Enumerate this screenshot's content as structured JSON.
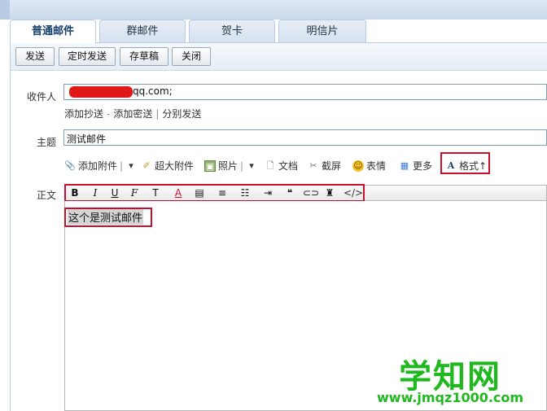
{
  "tabs": [
    {
      "label": "普通邮件",
      "active": true
    },
    {
      "label": "群邮件",
      "active": false
    },
    {
      "label": "贺卡",
      "active": false
    },
    {
      "label": "明信片",
      "active": false
    }
  ],
  "toolbar": {
    "send": "发送",
    "scheduled_send": "定时发送",
    "save_draft": "存草稿",
    "close": "关闭"
  },
  "recipient": {
    "label": "收件人",
    "value_visible": "qq.com;",
    "redaction_color": "#e01818"
  },
  "recipient_links": {
    "add_cc": "添加抄送",
    "dash": "-",
    "add_bcc": "添加密送",
    "pipe": "|",
    "separate_send": "分别发送"
  },
  "subject": {
    "label": "主题",
    "value": "测试邮件"
  },
  "attach_bar": {
    "add_attachment": "添加附件",
    "large_attachment": "超大附件",
    "photo": "照片",
    "document": "文档",
    "screenshot": "截屏",
    "emoji": "表情",
    "more": "更多",
    "format": "格式↑"
  },
  "body": {
    "label": "正文",
    "content": "这个是测试邮件"
  },
  "format_toolbar": {
    "icons": [
      "bold-icon",
      "italic-icon",
      "underline-icon",
      "font-icon",
      "font-size-icon",
      "font-color-icon",
      "background-color-icon",
      "align-icon",
      "bullet-list-icon",
      "indent-icon",
      "quote-icon",
      "link-icon",
      "clear-format-icon",
      "html-source-icon"
    ],
    "labels": [
      "B",
      "I",
      "U",
      "F",
      "T",
      "A",
      "▤",
      "≡",
      "☷",
      "⇥",
      "❝",
      "⊂⊃",
      "♜",
      "</>"
    ]
  },
  "watermark": {
    "main": "学知网",
    "url": "www.jmqz1000.com"
  },
  "colors": {
    "highlight_border": "#c8102e",
    "watermark": "#1fb81f",
    "active_tab_text": "#16406b"
  }
}
